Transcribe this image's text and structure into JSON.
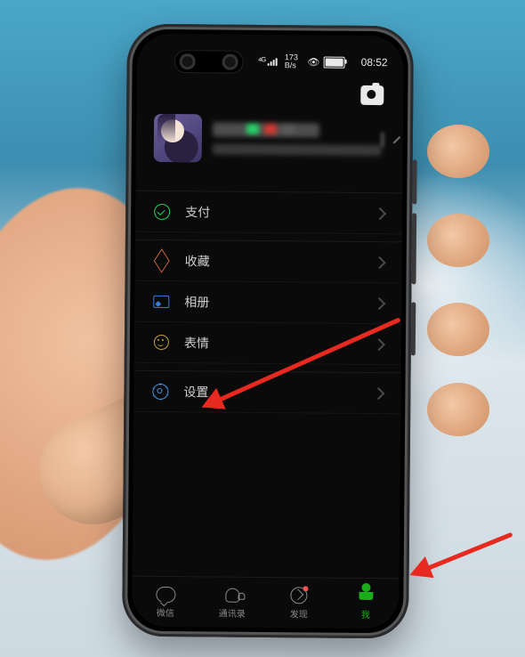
{
  "status": {
    "signal": "⁴ᴳ",
    "net_top": "173",
    "net_bottom": "B/s",
    "eye": "👁",
    "batt_num": "92",
    "time": "08:52"
  },
  "menu": {
    "pay": "支付",
    "fav": "收藏",
    "album": "相册",
    "emoji": "表情",
    "set": "设置"
  },
  "tabs": {
    "chat": "微信",
    "contacts": "通讯录",
    "discover": "发现",
    "me": "我"
  }
}
